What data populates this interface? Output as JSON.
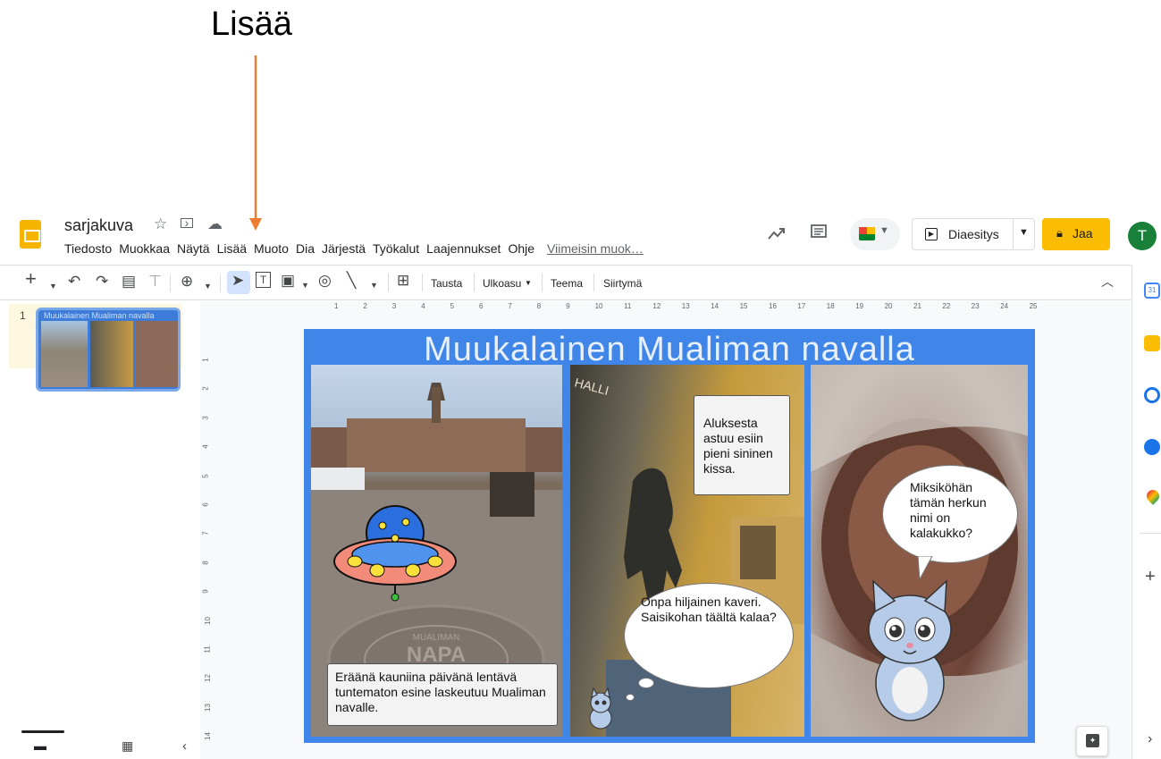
{
  "annotation": {
    "label": "Lisää",
    "arrow_color": "#ed7d31"
  },
  "app": {
    "title": "sarjakuva",
    "brand_color": "#f4b400"
  },
  "menu": [
    "Tiedosto",
    "Muokkaa",
    "Näytä",
    "Lisää",
    "Muoto",
    "Dia",
    "Järjestä",
    "Työkalut",
    "Laajennukset",
    "Ohje"
  ],
  "last_edit": "Viimeisin muok…",
  "header": {
    "present_label": "Diaesitys",
    "share_label": "Jaa",
    "avatar_initial": "T",
    "share_color": "#fbbc04",
    "avatar_color": "#188038"
  },
  "toolbar": {
    "background": "Tausta",
    "layout": "Ulkoasu",
    "theme": "Teema",
    "transition": "Siirtymä"
  },
  "filmstrip": {
    "slide_number": "1",
    "thumb_title": "Muukalainen Mualiman navalla"
  },
  "ruler_h": [
    "1",
    "2",
    "3",
    "4",
    "5",
    "6",
    "7",
    "8",
    "9",
    "10",
    "11",
    "12",
    "13",
    "14",
    "15",
    "16",
    "17",
    "18",
    "19",
    "20",
    "21",
    "22",
    "23",
    "24",
    "25"
  ],
  "ruler_v": [
    "1",
    "2",
    "3",
    "4",
    "5",
    "6",
    "7",
    "8",
    "9",
    "10",
    "11",
    "12",
    "13",
    "14"
  ],
  "slide": {
    "title": "Muukalainen Mualiman navalla",
    "panel1_caption": "Eräänä kauniina päivänä lentävä tuntematon esine laskeutuu Mualiman navalle.",
    "panel1_ground_text": "NAPA",
    "panel1_ground_small": "MUALIMAN",
    "panel2_scroll": "Aluksesta astuu esiin pieni sininen kissa.",
    "panel2_sign": "HALLI",
    "panel2_thought": "Onpa hiljainen kaveri. Saisikohan täältä kalaa?",
    "panel3_speech": "Miksiköhän tämän herkun nimi on kalakukko?"
  },
  "side_panel_icons": [
    "calendar-icon",
    "keep-icon",
    "tasks-icon",
    "contacts-icon",
    "maps-icon",
    "add-icon"
  ]
}
